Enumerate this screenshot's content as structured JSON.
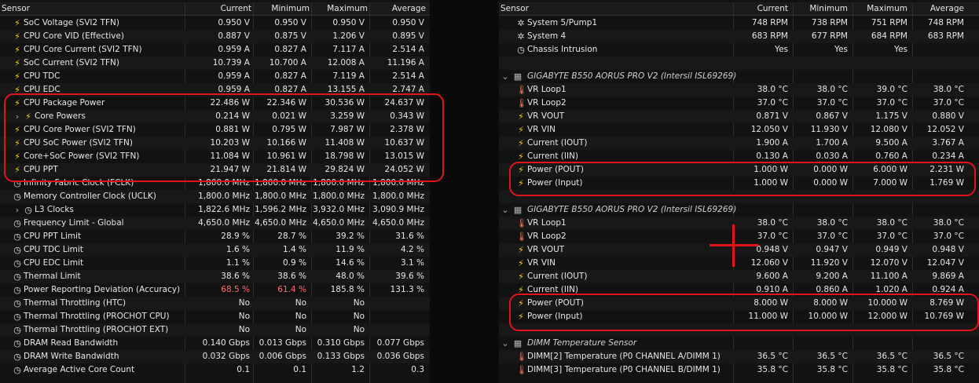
{
  "headers": {
    "sensor": "Sensor",
    "current": "Current",
    "minimum": "Minimum",
    "maximum": "Maximum",
    "average": "Average"
  },
  "left_rows": [
    {
      "icon": "bolt",
      "label": "SoC Voltage (SVI2 TFN)",
      "cur": "0.950 V",
      "min": "0.950 V",
      "max": "0.950 V",
      "avg": "0.950 V"
    },
    {
      "icon": "bolt",
      "label": "CPU Core VID (Effective)",
      "cur": "0.887 V",
      "min": "0.875 V",
      "max": "1.206 V",
      "avg": "0.895 V"
    },
    {
      "icon": "bolt",
      "label": "CPU Core Current (SVI2 TFN)",
      "cur": "0.959 A",
      "min": "0.827 A",
      "max": "7.117 A",
      "avg": "2.514 A"
    },
    {
      "icon": "bolt",
      "label": "SoC Current (SVI2 TFN)",
      "cur": "10.739 A",
      "min": "10.700 A",
      "max": "12.008 A",
      "avg": "11.196 A"
    },
    {
      "icon": "bolt",
      "label": "CPU TDC",
      "cur": "0.959 A",
      "min": "0.827 A",
      "max": "7.119 A",
      "avg": "2.514 A"
    },
    {
      "icon": "bolt",
      "label": "CPU EDC",
      "cur": "0.959 A",
      "min": "0.827 A",
      "max": "13.155 A",
      "avg": "2.747 A"
    },
    {
      "icon": "bolt",
      "label": "CPU Package Power",
      "cur": "22.486 W",
      "min": "22.346 W",
      "max": "30.536 W",
      "avg": "24.637 W"
    },
    {
      "icon": "bolt",
      "expand": true,
      "label": "Core Powers",
      "cur": "0.214 W",
      "min": "0.021 W",
      "max": "3.259 W",
      "avg": "0.343 W"
    },
    {
      "icon": "bolt",
      "label": "CPU Core Power (SVI2 TFN)",
      "cur": "0.881 W",
      "min": "0.795 W",
      "max": "7.987 W",
      "avg": "2.378 W"
    },
    {
      "icon": "bolt",
      "label": "CPU SoC Power (SVI2 TFN)",
      "cur": "10.203 W",
      "min": "10.166 W",
      "max": "11.408 W",
      "avg": "10.637 W"
    },
    {
      "icon": "bolt",
      "label": "Core+SoC Power (SVI2 TFN)",
      "cur": "11.084 W",
      "min": "10.961 W",
      "max": "18.798 W",
      "avg": "13.015 W"
    },
    {
      "icon": "bolt",
      "label": "CPU PPT",
      "cur": "21.947 W",
      "min": "21.814 W",
      "max": "29.824 W",
      "avg": "24.052 W"
    },
    {
      "icon": "clock",
      "label": "Infinity Fabric Clock (FCLK)",
      "cur": "1,800.0 MHz",
      "min": "1,800.0 MHz",
      "max": "1,800.0 MHz",
      "avg": "1,800.0 MHz"
    },
    {
      "icon": "clock",
      "label": "Memory Controller Clock (UCLK)",
      "cur": "1,800.0 MHz",
      "min": "1,800.0 MHz",
      "max": "1,800.0 MHz",
      "avg": "1,800.0 MHz"
    },
    {
      "icon": "clock",
      "expand": true,
      "label": "L3 Clocks",
      "cur": "1,822.6 MHz",
      "min": "1,596.2 MHz",
      "max": "3,932.0 MHz",
      "avg": "3,090.9 MHz"
    },
    {
      "icon": "clock",
      "label": "Frequency Limit - Global",
      "cur": "4,650.0 MHz",
      "min": "4,650.0 MHz",
      "max": "4,650.0 MHz",
      "avg": "4,650.0 MHz"
    },
    {
      "icon": "clock",
      "label": "CPU PPT Limit",
      "cur": "28.9 %",
      "min": "28.7 %",
      "max": "39.2 %",
      "avg": "31.6 %"
    },
    {
      "icon": "clock",
      "label": "CPU TDC Limit",
      "cur": "1.6 %",
      "min": "1.4 %",
      "max": "11.9 %",
      "avg": "4.2 %"
    },
    {
      "icon": "clock",
      "label": "CPU EDC Limit",
      "cur": "1.1 %",
      "min": "0.9 %",
      "max": "14.6 %",
      "avg": "3.1 %"
    },
    {
      "icon": "clock",
      "label": "Thermal Limit",
      "cur": "38.6 %",
      "min": "38.6 %",
      "max": "48.0 %",
      "avg": "39.6 %"
    },
    {
      "icon": "clock",
      "label": "Power Reporting Deviation (Accuracy)",
      "cur": "68.5 %",
      "min": "61.4 %",
      "max": "185.8 %",
      "avg": "131.3 %",
      "red": [
        "cur",
        "min"
      ]
    },
    {
      "icon": "clock",
      "label": "Thermal Throttling (HTC)",
      "cur": "No",
      "min": "No",
      "max": "No",
      "avg": ""
    },
    {
      "icon": "clock",
      "label": "Thermal Throttling (PROCHOT CPU)",
      "cur": "No",
      "min": "No",
      "max": "No",
      "avg": ""
    },
    {
      "icon": "clock",
      "label": "Thermal Throttling (PROCHOT EXT)",
      "cur": "No",
      "min": "No",
      "max": "No",
      "avg": ""
    },
    {
      "icon": "clock",
      "label": "DRAM Read Bandwidth",
      "cur": "0.140 Gbps",
      "min": "0.013 Gbps",
      "max": "0.310 Gbps",
      "avg": "0.077 Gbps"
    },
    {
      "icon": "clock",
      "label": "DRAM Write Bandwidth",
      "cur": "0.032 Gbps",
      "min": "0.006 Gbps",
      "max": "0.133 Gbps",
      "avg": "0.036 Gbps"
    },
    {
      "icon": "clock",
      "label": "Average Active Core Count",
      "cur": "0.1",
      "min": "0.1",
      "max": "1.2",
      "avg": "0.3"
    }
  ],
  "right_rows": [
    {
      "icon": "fan",
      "label": "System 5/Pump1",
      "cur": "748 RPM",
      "min": "738 RPM",
      "max": "751 RPM",
      "avg": "748 RPM"
    },
    {
      "icon": "fan",
      "label": "System 4",
      "cur": "683 RPM",
      "min": "677 RPM",
      "max": "684 RPM",
      "avg": "683 RPM"
    },
    {
      "icon": "clock",
      "label": "Chassis Intrusion",
      "cur": "Yes",
      "min": "Yes",
      "max": "Yes",
      "avg": ""
    },
    {
      "blank": true
    },
    {
      "group": true,
      "label": "GIGABYTE B550 AORUS PRO V2 (Intersil ISL69269)"
    },
    {
      "icon": "therm",
      "label": "VR Loop1",
      "cur": "38.0 °C",
      "min": "38.0 °C",
      "max": "39.0 °C",
      "avg": "38.0 °C"
    },
    {
      "icon": "therm",
      "label": "VR Loop2",
      "cur": "37.0 °C",
      "min": "37.0 °C",
      "max": "37.0 °C",
      "avg": "37.0 °C"
    },
    {
      "icon": "bolt",
      "label": "VR VOUT",
      "cur": "0.871 V",
      "min": "0.867 V",
      "max": "1.175 V",
      "avg": "0.880 V"
    },
    {
      "icon": "bolt",
      "label": "VR VIN",
      "cur": "12.050 V",
      "min": "11.930 V",
      "max": "12.080 V",
      "avg": "12.052 V"
    },
    {
      "icon": "bolt",
      "label": "Current (IOUT)",
      "cur": "1.900 A",
      "min": "1.700 A",
      "max": "9.500 A",
      "avg": "3.767 A"
    },
    {
      "icon": "bolt",
      "label": "Current (IIN)",
      "cur": "0.130 A",
      "min": "0.030 A",
      "max": "0.760 A",
      "avg": "0.234 A"
    },
    {
      "icon": "bolt",
      "label": "Power (POUT)",
      "cur": "1.000 W",
      "min": "0.000 W",
      "max": "6.000 W",
      "avg": "2.231 W"
    },
    {
      "icon": "bolt",
      "label": "Power (Input)",
      "cur": "1.000 W",
      "min": "0.000 W",
      "max": "7.000 W",
      "avg": "1.769 W"
    },
    {
      "blank": true
    },
    {
      "group": true,
      "label": "GIGABYTE B550 AORUS PRO V2 (Intersil ISL69269)"
    },
    {
      "icon": "therm",
      "label": "VR Loop1",
      "cur": "38.0 °C",
      "min": "38.0 °C",
      "max": "38.0 °C",
      "avg": "38.0 °C"
    },
    {
      "icon": "therm",
      "label": "VR Loop2",
      "cur": "37.0 °C",
      "min": "37.0 °C",
      "max": "37.0 °C",
      "avg": "37.0 °C"
    },
    {
      "icon": "bolt",
      "label": "VR VOUT",
      "cur": "0.948 V",
      "min": "0.947 V",
      "max": "0.949 V",
      "avg": "0.948 V"
    },
    {
      "icon": "bolt",
      "label": "VR VIN",
      "cur": "12.060 V",
      "min": "11.920 V",
      "max": "12.070 V",
      "avg": "12.047 V"
    },
    {
      "icon": "bolt",
      "label": "Current (IOUT)",
      "cur": "9.600 A",
      "min": "9.200 A",
      "max": "11.100 A",
      "avg": "9.869 A"
    },
    {
      "icon": "bolt",
      "label": "Current (IIN)",
      "cur": "0.910 A",
      "min": "0.860 A",
      "max": "1.020 A",
      "avg": "0.924 A"
    },
    {
      "icon": "bolt",
      "label": "Power (POUT)",
      "cur": "8.000 W",
      "min": "8.000 W",
      "max": "10.000 W",
      "avg": "8.769 W"
    },
    {
      "icon": "bolt",
      "label": "Power (Input)",
      "cur": "11.000 W",
      "min": "10.000 W",
      "max": "12.000 W",
      "avg": "10.769 W"
    },
    {
      "blank": true
    },
    {
      "group": true,
      "label": "DIMM Temperature Sensor"
    },
    {
      "icon": "therm",
      "label": "DIMM[2] Temperature (P0 CHANNEL A/DIMM 1)",
      "cur": "36.5 °C",
      "min": "36.5 °C",
      "max": "36.5 °C",
      "avg": "36.5 °C"
    },
    {
      "icon": "therm",
      "label": "DIMM[3] Temperature (P0 CHANNEL B/DIMM 1)",
      "cur": "35.8 °C",
      "min": "35.8 °C",
      "max": "35.8 °C",
      "avg": "35.8 °C"
    }
  ],
  "icons": {
    "bolt": "⚡",
    "clock": "◷",
    "therm": "🌡",
    "fan": "✲",
    "chip": "▦",
    "chev": "›"
  },
  "colors": {
    "highlight": "#e0151c",
    "bolt": "#ffd21a",
    "deviation": "#ff6b6b"
  }
}
